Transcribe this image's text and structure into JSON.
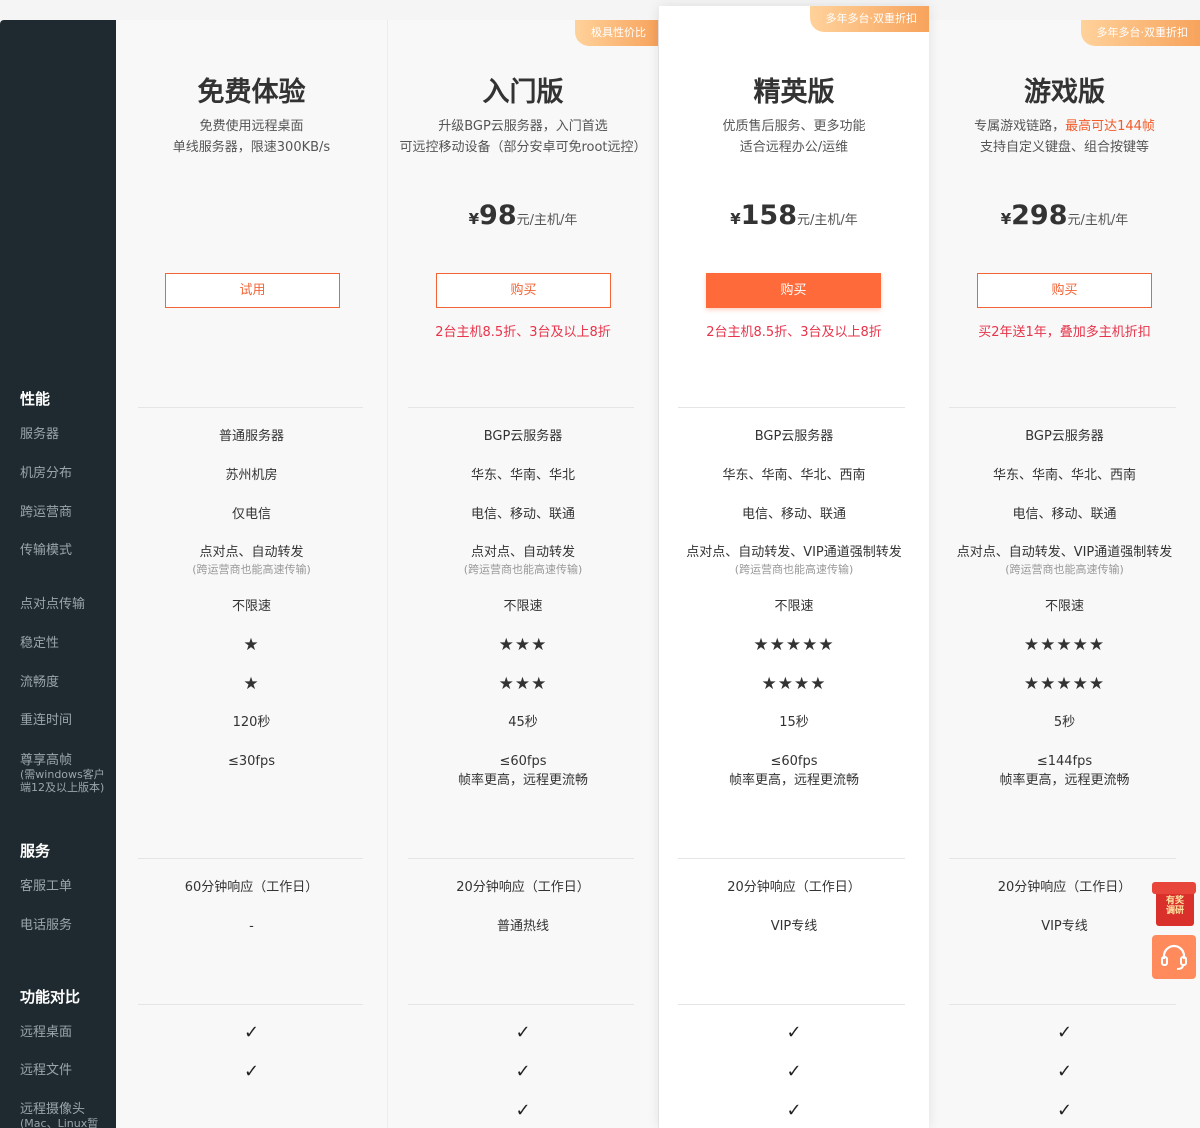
{
  "sidebar": {
    "sections": {
      "performance": "性能",
      "service": "服务",
      "features": "功能对比"
    },
    "items": {
      "server": "服务器",
      "location": "机房分布",
      "cross_isp": "跨运营商",
      "transfer": "传输模式",
      "p2p": "点对点传输",
      "stability": "稳定性",
      "smoothness": "流畅度",
      "reconnect": "重连时间",
      "fps": "尊享高帧",
      "fps_note": "(需windows客户端12及以上版本)",
      "ticket": "客服工单",
      "phone": "电话服务",
      "remote_desktop": "远程桌面",
      "remote_file": "远程文件",
      "remote_camera": "远程摄像头",
      "remote_camera_note": "(Mac、Linux暂"
    }
  },
  "plans": [
    {
      "title": "免费体验",
      "desc1": "免费使用远程桌面",
      "desc2": "单线服务器，限速300KB/s",
      "button": "试用",
      "server": "普通服务器",
      "location": "苏州机房",
      "cross_isp": "仅电信",
      "transfer": "点对点、自动转发",
      "transfer_note": "(跨运营商也能高速传输)",
      "p2p": "不限速",
      "stability": "★",
      "smoothness": "★",
      "reconnect": "120秒",
      "fps": "≤30fps",
      "ticket": "60分钟响应（工作日）",
      "phone": "-"
    },
    {
      "title": "入门版",
      "badge": "极具性价比",
      "desc1": "升级BGP云服务器，入门首选",
      "desc2": "可远控移动设备（部分安卓可免root远控）",
      "price_symbol": "¥",
      "price": "98",
      "price_unit": "元/主机/年",
      "button": "购买",
      "promo": "2台主机8.5折、3台及以上8折",
      "server": "BGP云服务器",
      "location": "华东、华南、华北",
      "cross_isp": "电信、移动、联通",
      "transfer": "点对点、自动转发",
      "transfer_note": "(跨运营商也能高速传输)",
      "p2p": "不限速",
      "stability": "★★★",
      "smoothness": "★★★",
      "reconnect": "45秒",
      "fps": "≤60fps",
      "fps_note": "帧率更高，远程更流畅",
      "ticket": "20分钟响应（工作日）",
      "phone": "普通热线"
    },
    {
      "title": "精英版",
      "badge": "多年多台·双重折扣",
      "desc1": "优质售后服务、更多功能",
      "desc2": "适合远程办公/运维",
      "price_symbol": "¥",
      "price": "158",
      "price_unit": "元/主机/年",
      "button": "购买",
      "promo": "2台主机8.5折、3台及以上8折",
      "server": "BGP云服务器",
      "location": "华东、华南、华北、西南",
      "cross_isp": "电信、移动、联通",
      "transfer": "点对点、自动转发、VIP通道强制转发",
      "transfer_note": "(跨运营商也能高速传输)",
      "p2p": "不限速",
      "stability": "★★★★★",
      "smoothness": "★★★★",
      "reconnect": "15秒",
      "fps": "≤60fps",
      "fps_note": "帧率更高，远程更流畅",
      "ticket": "20分钟响应（工作日）",
      "phone": "VIP专线"
    },
    {
      "title": "游戏版",
      "badge": "多年多台·双重折扣",
      "desc1a": "专属游戏链路，",
      "desc1b": "最高可达144帧",
      "desc2": "支持自定义键盘、组合按键等",
      "price_symbol": "¥",
      "price": "298",
      "price_unit": "元/主机/年",
      "button": "购买",
      "promo": "买2年送1年，叠加多主机折扣",
      "server": "BGP云服务器",
      "location": "华东、华南、华北、西南",
      "cross_isp": "电信、移动、联通",
      "transfer": "点对点、自动转发、VIP通道强制转发",
      "transfer_note": "(跨运营商也能高速传输)",
      "p2p": "不限速",
      "stability": "★★★★★",
      "smoothness": "★★★★★",
      "reconnect": "5秒",
      "fps": "≤144fps",
      "fps_note": "帧率更高，远程更流畅",
      "ticket": "20分钟响应（工作日）",
      "phone": "VIP专线"
    }
  ],
  "check_glyph": "✓",
  "floats": {
    "gift_line1": "有奖",
    "gift_line2": "调研"
  },
  "colors": {
    "accent": "#ff6a3a",
    "promo": "#e8334a",
    "sidebar": "#1f2a30"
  }
}
